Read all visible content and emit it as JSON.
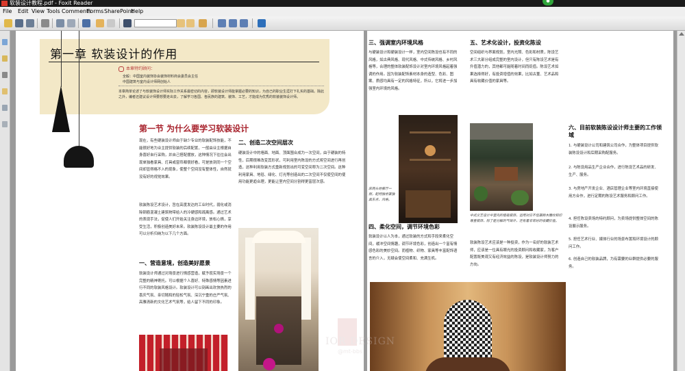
{
  "window": {
    "title": "软装设计教程.pdf - Foxit Reader"
  },
  "menu": [
    "File",
    "Edit",
    "View",
    "Tools",
    "Comments",
    "Forms",
    "SharePoint",
    "Help"
  ],
  "toolbar": {
    "search_value": ""
  },
  "left_page": {
    "chapter_title": "第一章 软装设计的作用",
    "advisor_heading": "本章特约顾问：",
    "advisor_lines": [
      "全毅：中国室内装饰协会装饰材料商会委员会主任",
      "中国建筑与室内设计师网创始人"
    ],
    "intro": "本章简单论述了与软装饰设计师实际工作关系最密切的内容，即软装设计师能掌握必要的知识，为自己的职业生涯打下扎实的基础。除此之外，编者还建议设计师要想要走出去，了解学习各国、各民族的建筑、装饰、工艺，才能成为优秀的软装装饰设计师。",
    "section_title": "第一节  为什么要学习软装设计",
    "col1_p1": "现在，有些硬装设计师由于缺少专业的软装配饰技能，不能很好地为业主提供软装的后续配置，一般由业主根据自身喜好自行采购，并自己搭配摆放，这种情况下往往会出现单独看家具、灯具或窗帘都很好看，可是放到同一个空间却显得格不入的现象，使整个空间没有整体性，自然就没有好的视觉效果。",
    "col1_p2": "软装陈设艺术设计，旨在高度发达的工业时代，弱化或消除钢筋混凝土建筑物带给人的冷硬感和疏离感。通过艺术的表现手法，促使人们开始关注身边环境，放松心情，享受生活，积极创造美好未来。软装陈设设计最主要的作用可以分析归纳为以下几个方面。",
    "h_1": "一、营造意境，创造美好愿景",
    "col1_p3": "软装设计师通过对场景进行情感营造，赋予现实场景一个完整的精神寄托。可以根据个人喜好、特殊感情等因素进行不同的软装风格设计。软装设计可以刻画出欢快热烈的喜庆气氛、亲切随和的轻松气氛、深沉宁重的庄严气氛、高雅清新的文化艺术气氛等，给人留下不同的印象。",
    "h_2": "二、创造二次空间层次",
    "col2_p1": "硬装设计中的墙面、地面、顶面围合成为一次空间，由于硬装的特性，后期很难改变其形状，可利用室内陈设的方式将空间进行再创造，这种利用软装方式重新规划出的可变空间称为二次空间。这种利用家具、地毯、绿化、灯光等创造出的二次空间不仅使空间的使用功能更趋合理，更能让室内空间分割得更富层次感。"
  },
  "right_page": {
    "h_3": "三、强调室内环境风格",
    "col1_p1": "与硬装设计和硬装设计一样，室内空间陈设也有不同的风格，如古典风格、现代风格、中式传统风格、乡村风格等，合理的整体软装配饰设计对室内环境风格起着强调的作用。因为软装配饰素材本身的造型、色彩、图案、质感均具有一定的风格特征，所以，它将进一步加强室内环境的风格。",
    "cap_1": "床两头地餐厅一侧，配特独世兼独具东点、风格。",
    "h_4": "四、柔化空间，调节环境色彩",
    "col1_p2": "软装设计以人为本，通过软装的方式和手段来柔化空间，缓冲空间情趣，调节环境色彩，创造出一个富有情感色彩的美妙空间。而植物、织物、家具等丰富配饰语言的介入，无疑会使空间柔和、充满生机。",
    "h_5": "五、艺术化设计，投资化陈设",
    "col2_p1": "空间组织与界面规划，室内光照、色彩和材质，陈设艺术三大部分组成完整的室内设计，但只有陈设艺术是有升值潜力的，其他都可能随着时间而贬值。陈设艺术如果选择得好，有投资增值的效果，比如古董、艺术品和具有收藏价值的家具等。",
    "cap_2": "中式文艺设计中室内的植栽装饰，运用对应不但兼顾木雕纹和印等重装饰，除了能分解的气味外，还有着非常好的收藏价值。",
    "col2_p2": "软装陈设艺术应该是一种投资，作为一名好的软装艺术师，应该是一位具有眼光的投资顾问和收藏家，为客户配置既美观又有经济效益的陈设，是软装设计师努力的方向。",
    "h_6": "六、目前软装陈设设计师主要的工作领域",
    "list": [
      "1. 与硬装设计公司和建筑公司合作，为整体项目提供软装陈设设计和后期采购配服务。",
      "2. 与陈设用品生产企业合作，进行陈设艺术品的研发、生产、服务。",
      "3. 与房地产开发企业、酒店管理企业等室内环境直接使用方合作，进行定期的陈设艺术服务和顾问工作。",
      "4. 担任陈设卖场的特约顾问，为卖场提供整体空间的陈设展示服务。",
      "5. 担任艺术行业、媒体行业的场景布置和环境设计的顾问工作。",
      "6. 创造自己的软装品牌，为有需要的业群提供必要的服务。"
    ]
  },
  "watermark": {
    "line1": "IOR DESIGN",
    "line2": "@mt-bbs"
  },
  "colors": {
    "accent_red": "#a8232d",
    "banner": "#f3e8c7"
  }
}
